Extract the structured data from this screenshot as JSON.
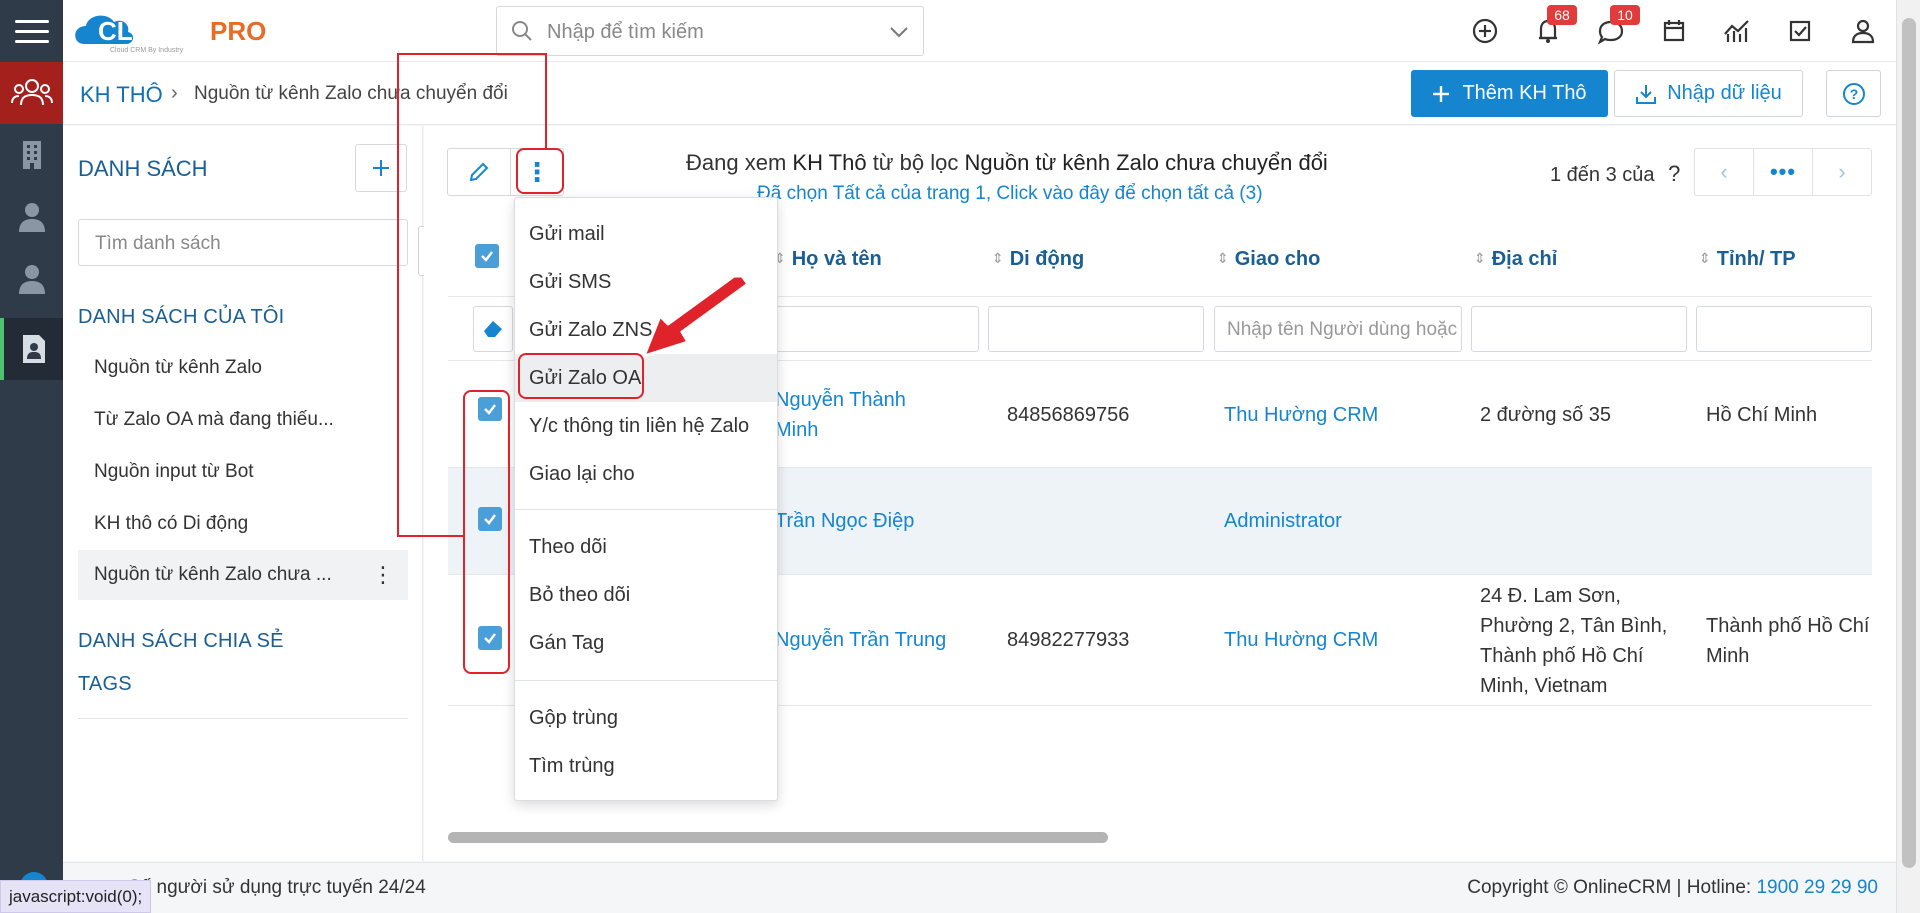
{
  "topbar": {
    "search_placeholder": "Nhập để tìm kiếm",
    "notifications_count": "68",
    "messages_count": "10"
  },
  "breadcrumb": {
    "root": "KH THÔ",
    "current": "Nguồn từ kênh Zalo chưa chuyển đổi"
  },
  "actions": {
    "add_label": "Thêm KH Thô",
    "import_label": "Nhập dữ liệu"
  },
  "lists_panel": {
    "title": "DANH SÁCH",
    "search_placeholder": "Tìm danh sách",
    "my_lists_heading": "DANH SÁCH CỦA TÔI",
    "items": [
      "Nguồn từ kênh Zalo",
      "Từ Zalo OA mà đang thiếu...",
      "Nguồn input từ Bot",
      "KH thô có Di động",
      "Nguồn từ kênh Zalo chưa ..."
    ],
    "shared_heading": "DANH SÁCH CHIA SẺ",
    "tags_heading": "TAGS"
  },
  "view": {
    "prefix": "Đang xem ",
    "module": "KH Thô",
    "mid": " từ bộ lọc ",
    "filter": "Nguồn từ kênh Zalo chưa chuyển đổi",
    "selection_note": "Đã chọn Tất cả của trang 1, Click vào đây để chọn tất cả (3)",
    "page_info": "1 đến 3 của",
    "page_unknown": "?"
  },
  "table": {
    "columns": [
      "Họ và tên",
      "Di động",
      "Giao cho",
      "Địa chỉ",
      "Tỉnh/ TP"
    ],
    "assignee_filter_placeholder": "Nhập tên Người dùng hoặc",
    "rows": [
      {
        "name_l1": "Nguyễn Thành",
        "name_l2": "Minh",
        "mobile": "84856869756",
        "assignee": "Thu Hường CRM",
        "address": "2 đường số 35",
        "city": "Hồ Chí Minh"
      },
      {
        "name_l1": "Trần Ngọc Điệp",
        "name_l2": "",
        "mobile": "",
        "assignee": "Administrator",
        "address": "",
        "city": ""
      },
      {
        "name_l1": "Nguyễn Trần Trung",
        "name_l2": "",
        "mobile": "84982277933",
        "assignee": "Thu Hường CRM",
        "address_lines": [
          "24 Đ. Lam Sơn,",
          "Phường 2, Tân Bình,",
          "Thành phố Hồ Chí",
          "Minh, Vietnam"
        ],
        "city_lines": [
          "Thành phố Hồ Chí",
          "Minh"
        ]
      }
    ]
  },
  "dropdown": {
    "items": [
      "Gửi mail",
      "Gửi SMS",
      "Gửi Zalo ZNS",
      "Gửi Zalo OA",
      "Y/c thông tin liên hệ Zalo",
      "Giao lại cho",
      "Theo dõi",
      "Bỏ theo dõi",
      "Gán Tag",
      "Gộp trùng",
      "Tìm trùng"
    ],
    "highlighted": "Gửi Zalo OA"
  },
  "footer": {
    "online_users": "Số người sử dụng trực tuyến 24/24",
    "copyright": "Copyright © OnlineCRM | Hotline: ",
    "hotline": "1900 29 29 90"
  },
  "status_url": "javascript:void(0);",
  "colors": {
    "brand": "#1585cf",
    "sidebar": "#2f3b49",
    "annotation": "#e0222a"
  }
}
